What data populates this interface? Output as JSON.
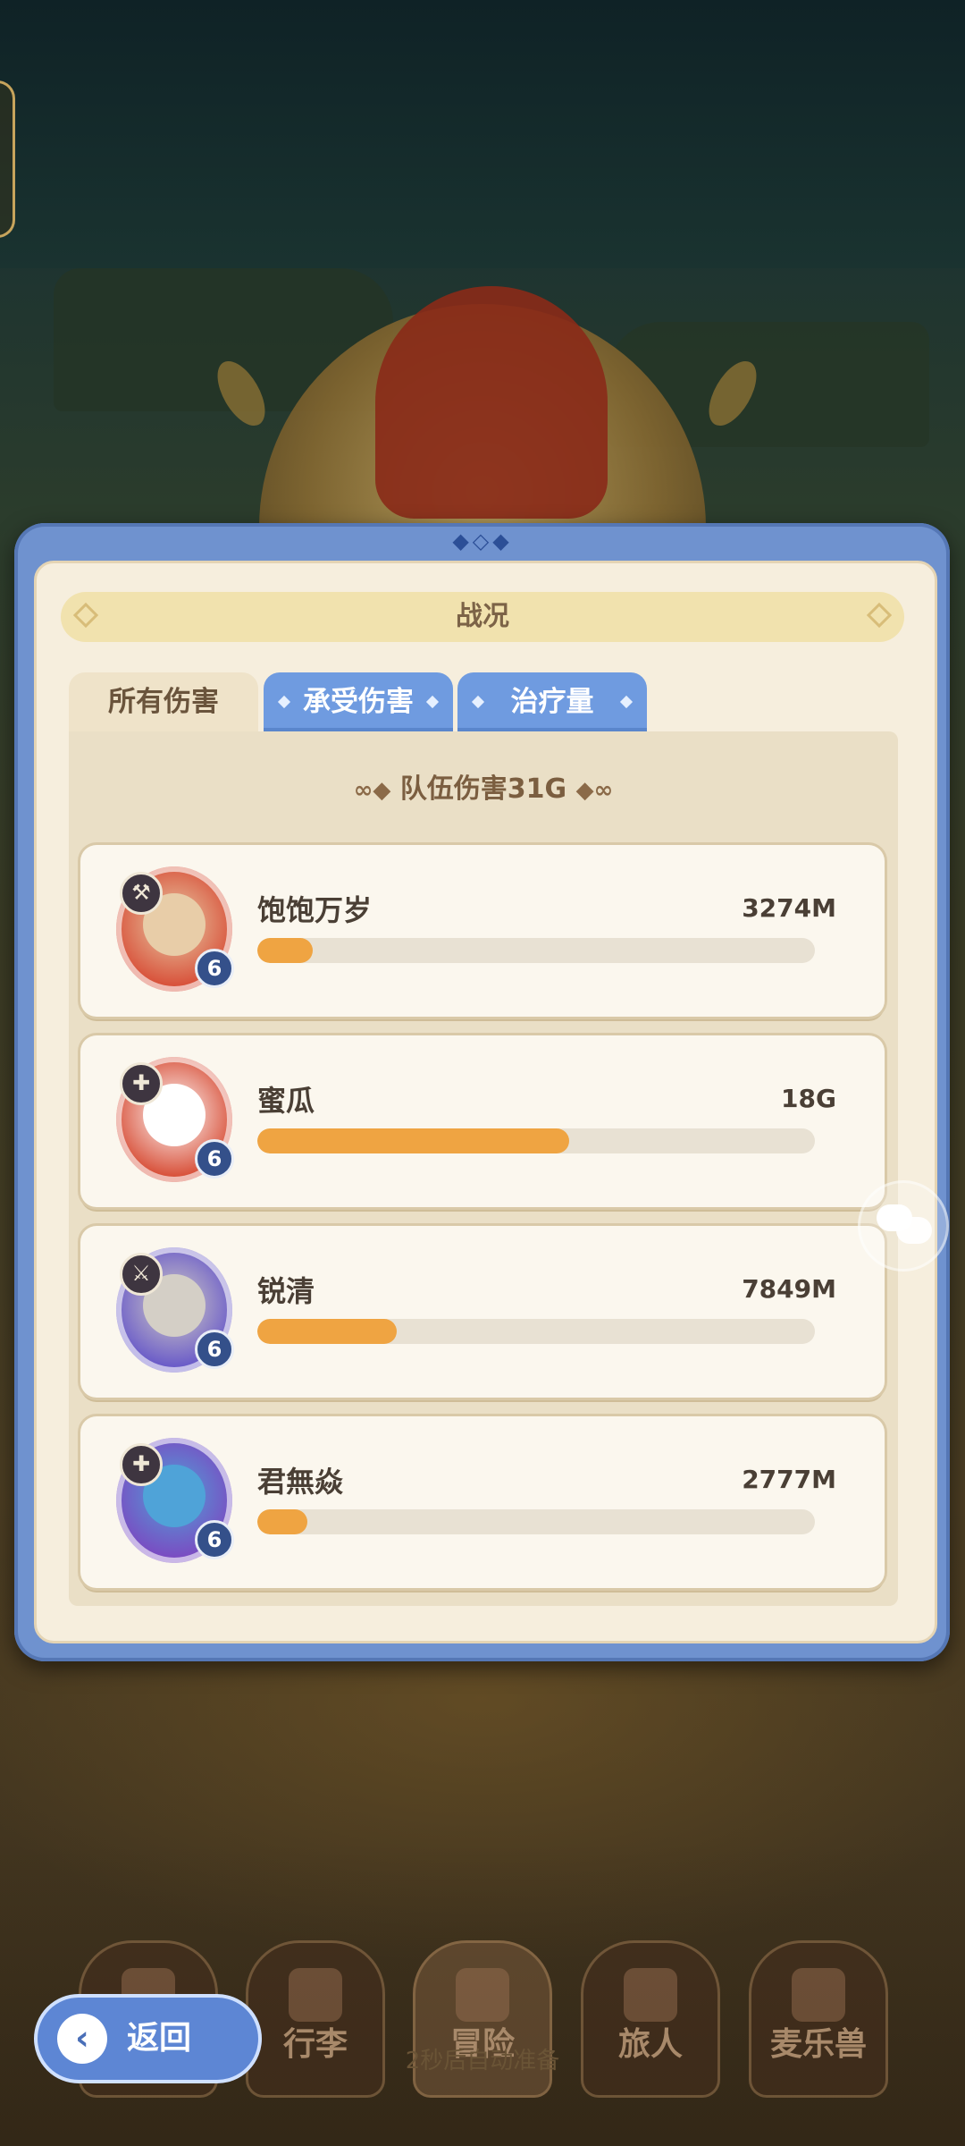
{
  "dialog": {
    "title": "战况",
    "tabs": [
      {
        "label": "所有伤害",
        "active": true
      },
      {
        "label": "承受伤害",
        "active": false
      },
      {
        "label": "治疗量",
        "active": false
      }
    ],
    "team_total_label": "队伍伤害31G",
    "members": [
      {
        "name": "饱饱万岁",
        "value": "3274M",
        "level": "6",
        "class_icon": "pickaxe-icon",
        "bar_fraction": 0.1,
        "avatar_color": "#d8513a",
        "face_color": "#e8cda8"
      },
      {
        "name": "蜜瓜",
        "value": "18G",
        "level": "6",
        "class_icon": "cross-shield-icon",
        "bar_fraction": 0.56,
        "avatar_color": "#d8513a",
        "face_color": "#ffffff"
      },
      {
        "name": "锐清",
        "value": "7849M",
        "level": "6",
        "class_icon": "swords-icon",
        "bar_fraction": 0.25,
        "avatar_color": "#6a5bc8",
        "face_color": "#d4cfc6"
      },
      {
        "name": "君無焱",
        "value": "2777M",
        "level": "6",
        "class_icon": "cross-shield-icon",
        "bar_fraction": 0.09,
        "avatar_color": "#7a4cc2",
        "face_color": "#4fa3d8"
      }
    ]
  },
  "bottom_nav": {
    "back_label": "返回",
    "items": [
      {
        "label": "",
        "icon": "castle-icon"
      },
      {
        "label": "行李",
        "icon": "chest-icon"
      },
      {
        "label": "冒险",
        "icon": "crossed-swords-icon"
      },
      {
        "label": "旅人",
        "icon": "traveler-icon"
      },
      {
        "label": "麦乐兽",
        "icon": "beast-icon"
      }
    ],
    "subtitle": "2秒后自动准备"
  },
  "colors": {
    "dialog_frame": "#6f92cf",
    "bar_fill": "#efa442",
    "tab_inactive": "#6f9be0"
  }
}
